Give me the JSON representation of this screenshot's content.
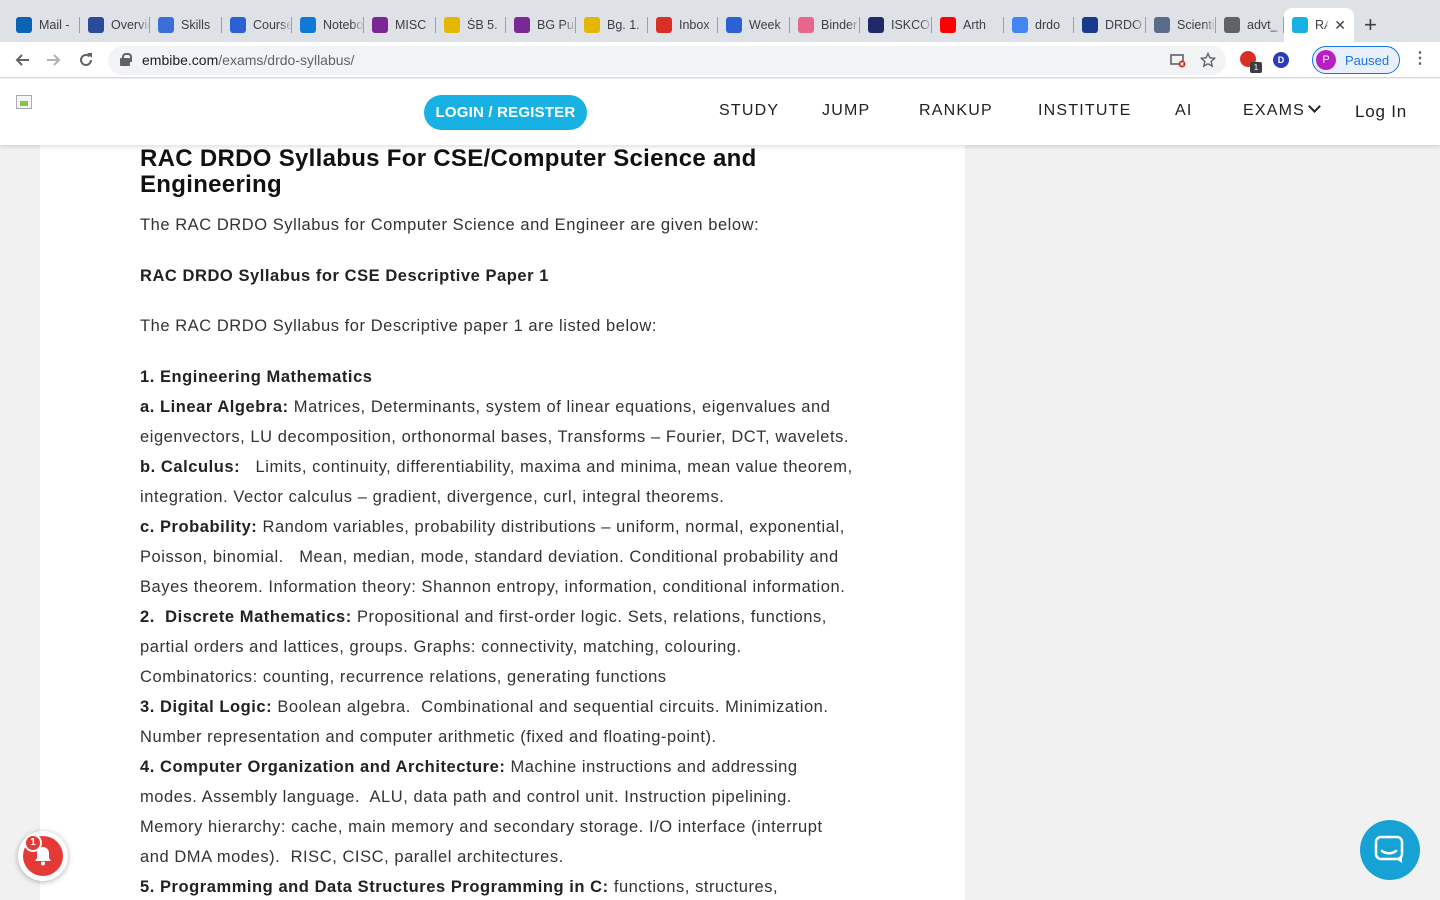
{
  "browser": {
    "tabs": [
      {
        "title": "Mail -",
        "icon": "outlook-icon",
        "color": "#0a64b4"
      },
      {
        "title": "Overview",
        "icon": "sap-icon",
        "color": "#2a4a9b"
      },
      {
        "title": "Skills",
        "icon": "skills-icon",
        "color": "#3b6fd8"
      },
      {
        "title": "Courses",
        "icon": "infinity-icon",
        "color": "#2a62d6"
      },
      {
        "title": "Notebook",
        "icon": "onedrive-icon",
        "color": "#0e7ad6"
      },
      {
        "title": "MISC",
        "icon": "onenote-icon",
        "color": "#7b2795"
      },
      {
        "title": "ŚB 5.",
        "icon": "v-icon",
        "color": "#e6b700"
      },
      {
        "title": "BG Purport",
        "icon": "onenote-icon",
        "color": "#7b2795"
      },
      {
        "title": "Bg. 1.",
        "icon": "v-icon",
        "color": "#e6b700"
      },
      {
        "title": "Inbox",
        "icon": "gmail-icon",
        "color": "#d93025"
      },
      {
        "title": "Week",
        "icon": "infinity-icon",
        "color": "#2a62d6"
      },
      {
        "title": "Binder",
        "icon": "binder-icon",
        "color": "#e8668b"
      },
      {
        "title": "ISKCON",
        "icon": "in-icon",
        "color": "#1f2a66"
      },
      {
        "title": "Arth",
        "icon": "youtube-icon",
        "color": "#ff0000"
      },
      {
        "title": "drdo",
        "icon": "google-icon",
        "color": "#4285f4"
      },
      {
        "title": "DRDO",
        "icon": "drdo-icon",
        "color": "#1a3a8c"
      },
      {
        "title": "Scientist",
        "icon": "emblem-icon",
        "color": "#5b6b8c"
      },
      {
        "title": "advt_",
        "icon": "globe-icon",
        "color": "#5f6368"
      },
      {
        "title": "RAC",
        "icon": "embibe-icon",
        "color": "#17b1e3"
      }
    ],
    "new_tab": "+",
    "close_tab": "✕",
    "url_domain": "embibe.com",
    "url_path": "/exams/drdo-syllabus/",
    "profile_initial": "P",
    "profile_status": "Paused",
    "ext_badge": "1",
    "ext_d": "D"
  },
  "site": {
    "login_register": "LOGIN / REGISTER",
    "nav": [
      "STUDY",
      "JUMP",
      "RANKUP",
      "INSTITUTE",
      "AI",
      "EXAMS",
      "Log In"
    ]
  },
  "article": {
    "heading_line1": "RAC DRDO Syllabus For CSE/Computer Science and",
    "heading_line2": "Engineering",
    "intro": "The RAC DRDO Syllabus for Computer Science and Engineer are given below:",
    "subheading": "RAC DRDO Syllabus for CSE Descriptive Paper 1",
    "list_intro": "The RAC DRDO Syllabus for Descriptive paper 1 are listed below:",
    "section1": "1. Engineering Mathematics",
    "a_label": "a. Linear Algebra:",
    "a_text1": " Matrices, Determinants, system of linear equations, eigenvalues and",
    "a_text2": "eigenvectors, LU decomposition, orthonormal bases, Transforms – Fourier, DCT, wavelets.",
    "b_label": "b. Calculus:",
    "b_text1": "   Limits, continuity, differentiability, maxima and minima, mean value theorem,",
    "b_text2": "integration. Vector calculus – gradient, divergence, curl, integral theorems.",
    "c_label": "c. Probability:",
    "c_text1": " Random variables, probability distributions – uniform, normal, exponential,",
    "c_text2": "Poisson, binomial.   Mean, median, mode, standard deviation. Conditional probability and",
    "c_text3": "Bayes theorem. Information theory: Shannon entropy, information, conditional information.",
    "s2_label": "2.  Discrete Mathematics:",
    "s2_text1": " Propositional and first-order logic. Sets, relations, functions,",
    "s2_text2": "partial orders and lattices, groups. Graphs: connectivity, matching, colouring.",
    "s2_text3": "Combinatorics: counting, recurrence relations, generating functions",
    "s3_label": "3. Digital Logic:",
    "s3_text1": " Boolean algebra.  Combinational and sequential circuits. Minimization.",
    "s3_text2": "Number representation and computer arithmetic (fixed and floating-point).",
    "s4_label": "4. Computer Organization and Architecture:",
    "s4_text1": " Machine instructions and addressing",
    "s4_text2": "modes. Assembly language.  ALU, data path and control unit. Instruction pipelining.",
    "s4_text3": "Memory hierarchy: cache, main memory and secondary storage. I/O interface (interrupt",
    "s4_text4": "and DMA modes).  RISC, CISC, parallel architectures.",
    "s5_label": "5. Programming and Data Structures Programming in C:",
    "s5_text1": " functions, structures,"
  },
  "widgets": {
    "notification_count": "1"
  },
  "colors": {
    "accent": "#17b1e3",
    "chat": "#17a2d6",
    "notification": "#e53935"
  }
}
